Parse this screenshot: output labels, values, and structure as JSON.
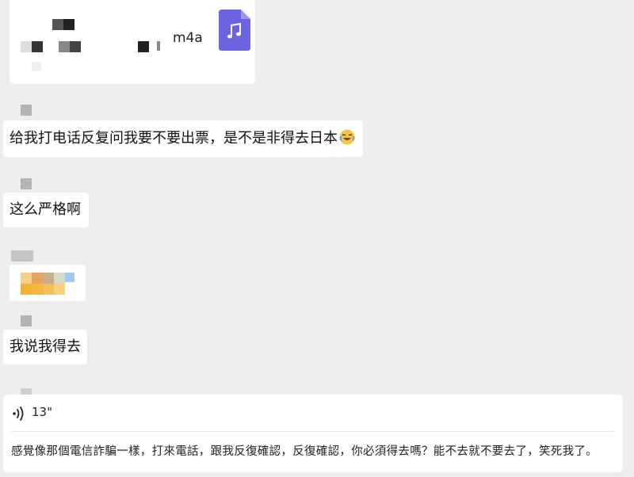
{
  "colors": {
    "background": "#ededed",
    "bubble": "#ffffff",
    "file_icon": "#6b63e0",
    "text": "#111111"
  },
  "file_message": {
    "name": "m4a",
    "icon": "music-file-icon"
  },
  "messages": [
    {
      "text": "给我打电话反复问我要不要出票，是不是非得去日本",
      "emoji": "laughing-crying-emoji"
    },
    {
      "text": "这么严格啊"
    },
    {
      "text": "我说我得去"
    }
  ],
  "voice_message": {
    "duration": "13\"",
    "icon": "voice-wave-icon",
    "transcript": "感覺像那個電信詐騙一樣，打來電話，跟我反復確認，反復確認，你必須得去嗎？能不去就不要去了，笑死我了。"
  }
}
